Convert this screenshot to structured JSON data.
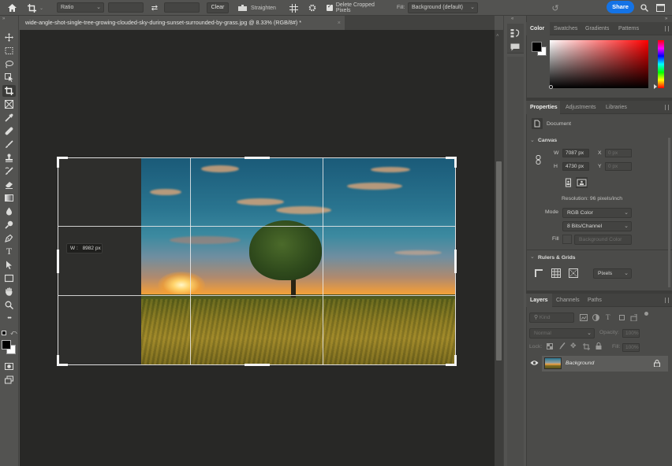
{
  "options_bar": {
    "home_icon": "home-icon",
    "crop_tool_icon": "crop-icon",
    "ratio_dropdown": "Ratio",
    "width_value": "",
    "height_value": "",
    "swap_icon": "swap-icon",
    "clear_label": "Clear",
    "straighten_label": "Straighten",
    "overlay_icon": "grid-overlay-icon",
    "settings_icon": "gear-icon",
    "delete_cropped_pixels_label": "Delete Cropped Pixels",
    "delete_cropped_pixels_checked": true,
    "fill_label": "Fill:",
    "fill_value": "Background (default)",
    "reset_icon": "undo-icon",
    "share_label": "Share",
    "search_icon": "search-icon",
    "workspace_icon": "workspace-icon"
  },
  "document_tab": {
    "title": "wide-angle-shot-single-tree-growing-clouded-sky-during-sunset-surrounded-by-grass.jpg @ 8.33% (RGB/8#) *",
    "close": "×"
  },
  "toolbar": {
    "tools": [
      {
        "name": "move-tool",
        "icon": "move-icon"
      },
      {
        "name": "marquee-tool",
        "icon": "rect-marquee-icon"
      },
      {
        "name": "lasso-tool",
        "icon": "lasso-icon"
      },
      {
        "name": "object-select-tool",
        "icon": "object-select-icon"
      },
      {
        "name": "crop-tool",
        "icon": "crop-icon",
        "active": true
      },
      {
        "name": "frame-tool",
        "icon": "frame-icon"
      },
      {
        "name": "eyedropper-tool",
        "icon": "eyedropper-icon"
      },
      {
        "name": "healing-tool",
        "icon": "bandage-icon"
      },
      {
        "name": "brush-tool",
        "icon": "brush-icon"
      },
      {
        "name": "clone-stamp-tool",
        "icon": "stamp-icon"
      },
      {
        "name": "history-brush-tool",
        "icon": "history-brush-icon"
      },
      {
        "name": "eraser-tool",
        "icon": "eraser-icon"
      },
      {
        "name": "gradient-tool",
        "icon": "gradient-icon"
      },
      {
        "name": "blur-tool",
        "icon": "drop-icon"
      },
      {
        "name": "dodge-tool",
        "icon": "dodge-icon"
      },
      {
        "name": "pen-tool",
        "icon": "pen-icon"
      },
      {
        "name": "type-tool",
        "icon": "type-icon",
        "glyph": "T"
      },
      {
        "name": "path-select-tool",
        "icon": "arrow-icon"
      },
      {
        "name": "shape-tool",
        "icon": "rectangle-icon"
      },
      {
        "name": "hand-tool",
        "icon": "hand-icon"
      },
      {
        "name": "zoom-tool",
        "icon": "zoom-icon"
      },
      {
        "name": "more-tools",
        "icon": "ellipsis-icon",
        "glyph": "•••"
      }
    ],
    "foreground_color": "#000000",
    "background_color": "#ffffff"
  },
  "canvas": {
    "width_tooltip_label": "W :",
    "width_tooltip_value": "8982 px"
  },
  "color_panel": {
    "tabs": [
      "Color",
      "Swatches",
      "Gradients",
      "Patterns"
    ],
    "active_tab": "Color",
    "hue_color": "#ff0000"
  },
  "properties_panel": {
    "tabs": [
      "Properties",
      "Adjustments",
      "Libraries"
    ],
    "active_tab": "Properties",
    "kind_label": "Document",
    "canvas_section": "Canvas",
    "w_label": "W",
    "w_value": "7087 px",
    "h_label": "H",
    "h_value": "4730 px",
    "x_label": "X",
    "x_value": "0 px",
    "y_label": "Y",
    "y_value": "0 px",
    "resolution": "Resolution: 96 pixels/inch",
    "mode_label": "Mode",
    "mode_value": "RGB Color",
    "depth_value": "8 Bits/Channel",
    "fill_label": "Fill",
    "fill_value": "Background Color",
    "rulers_section": "Rulers & Grids",
    "units_value": "Pixels"
  },
  "layers_panel": {
    "tabs": [
      "Layers",
      "Channels",
      "Paths"
    ],
    "active_tab": "Layers",
    "filter_placeholder": "Kind",
    "blend_mode": "Normal",
    "opacity_label": "Opacity:",
    "opacity_value": "100%",
    "lock_label": "Lock:",
    "fill_label": "Fill:",
    "fill_value": "100%",
    "layers": [
      {
        "name": "Background",
        "visible": true,
        "locked": true
      }
    ]
  }
}
